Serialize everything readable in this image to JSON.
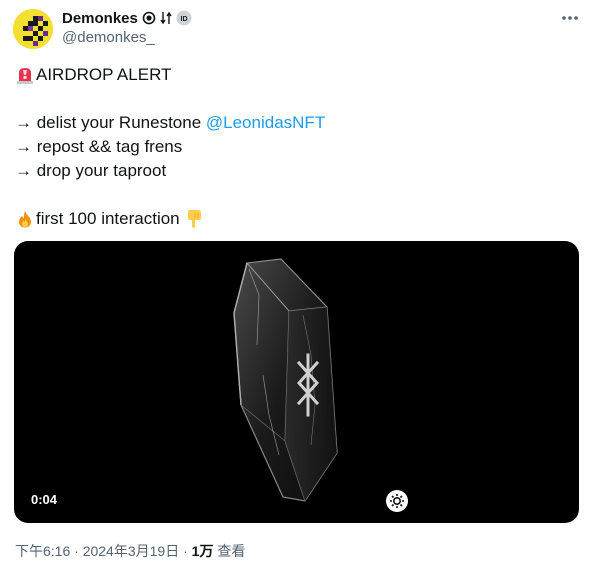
{
  "author": {
    "display_name": "Demonkes",
    "handle": "@demonkes_",
    "badge_icons": [
      "target-badge-icon",
      "transfer-badge-icon",
      "id-badge-icon"
    ],
    "avatar_color": "#f2df2f"
  },
  "tweet": {
    "line1_text": "AIRDROP ALERT",
    "line1_emoji": "police-light-icon",
    "line2_prefix": "→ delist your Runestone ",
    "line2_mention": "@LeonidasNFT",
    "line3_text": "→ repost && tag frens",
    "line4_text": "→ drop your taproot",
    "line5_text": "first 100 interaction ",
    "line5_emoji_before": "fire-icon",
    "line5_emoji_after": "pointing-down-icon"
  },
  "media": {
    "duration": "0:04",
    "background": "#000000"
  },
  "meta": {
    "time": "下午6:16",
    "separator": " · ",
    "date": "2024年3月19日",
    "views_count": "1万",
    "views_label": " 查看"
  },
  "colors": {
    "text": "#0f1419",
    "secondary": "#536471",
    "link": "#1d9bf0"
  }
}
